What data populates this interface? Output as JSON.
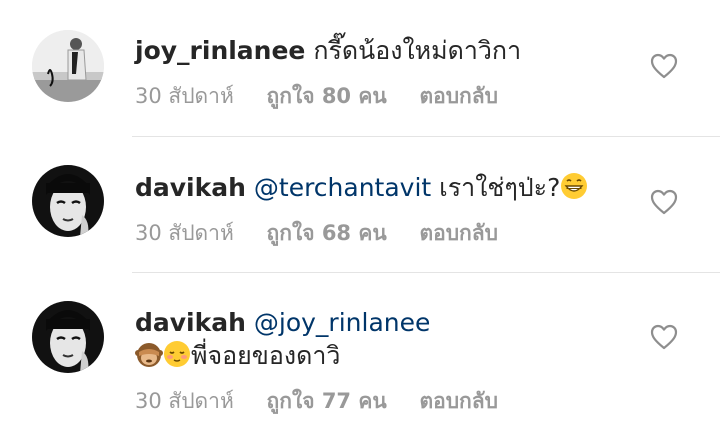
{
  "comments": [
    {
      "username": "joy_rinlanee",
      "mention": "",
      "text": "กรี๊ดน้องใหม่ดาวิกา",
      "time": "30 สัปดาห์",
      "likes": "ถูกใจ 80 คน",
      "reply": "ตอบกลับ"
    },
    {
      "username": "davikah",
      "mention": "@terchantavit",
      "text": " เราใช่ๆป่ะ?",
      "time": "30 สัปดาห์",
      "likes": "ถูกใจ 68 คน",
      "reply": "ตอบกลับ"
    },
    {
      "username": "davikah",
      "mention": "@joy_rinlanee",
      "text": "พี่จอยของดาวิ",
      "time": "30 สัปดาห์",
      "likes": "ถูกใจ 77 คน",
      "reply": "ตอบกลับ"
    }
  ],
  "icons": {
    "like": "heart-outline-icon",
    "emoji_grin": "grinning-face-icon",
    "emoji_monkey": "see-no-evil-monkey-icon",
    "emoji_blush": "relieved-face-icon"
  },
  "colors": {
    "mention": "#003569",
    "meta": "#999999",
    "divider": "#e4e4e4"
  }
}
